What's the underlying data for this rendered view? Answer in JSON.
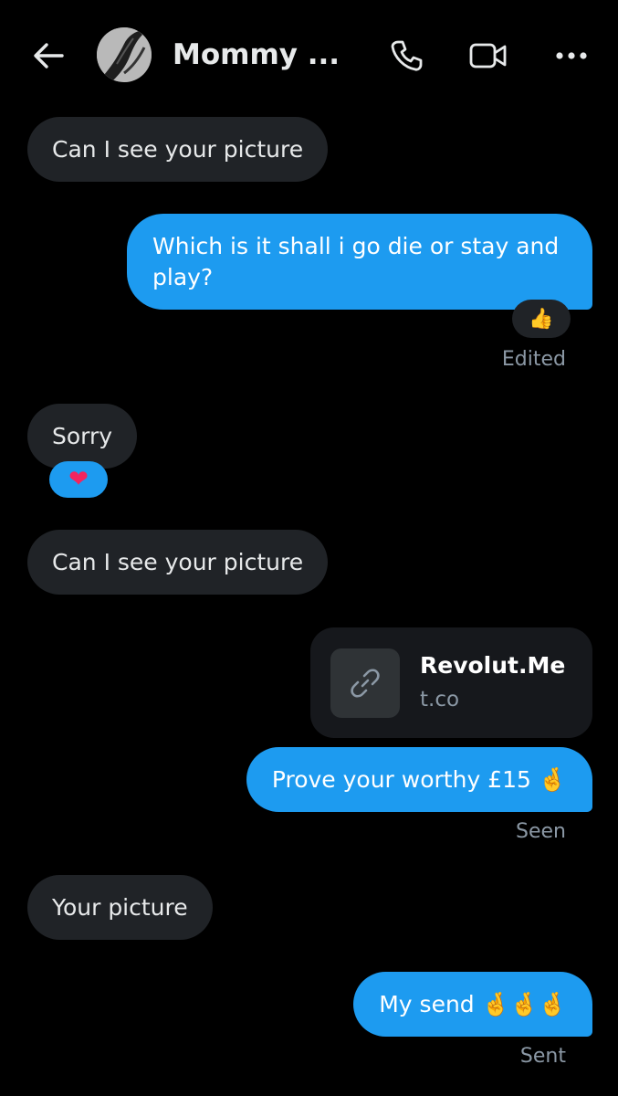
{
  "header": {
    "contact_name": "Mommy ...",
    "back_icon": "arrow-left-icon",
    "call_icon": "phone-icon",
    "video_icon": "video-camera-icon",
    "more_icon": "more-horizontal-icon"
  },
  "colors": {
    "background": "#000000",
    "incoming_bubble": "#202327",
    "outgoing_bubble": "#1d9bf0",
    "meta_text": "#8b98a5"
  },
  "messages": [
    {
      "direction": "incoming",
      "text": "Can I see your picture"
    },
    {
      "direction": "outgoing",
      "text": "Which is it shall i go die or stay and play?",
      "reaction": "👍",
      "status": "Edited"
    },
    {
      "direction": "incoming",
      "text": "Sorry",
      "reaction": "❤"
    },
    {
      "direction": "incoming",
      "text": "Can I see your picture"
    },
    {
      "direction": "outgoing",
      "type": "link",
      "title": "Revolut.Me",
      "domain": "t.co",
      "icon": "link-icon"
    },
    {
      "direction": "outgoing",
      "text": "Prove your worthy £15 🤞",
      "status": "Seen"
    },
    {
      "direction": "incoming",
      "text": "Your picture"
    },
    {
      "direction": "outgoing",
      "text": "My send 🤞🤞🤞",
      "status": "Sent"
    }
  ]
}
